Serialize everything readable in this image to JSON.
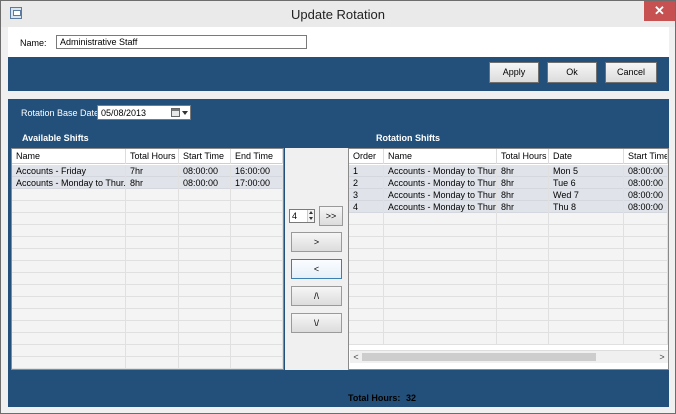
{
  "window": {
    "title": "Update Rotation",
    "close_label": "✕"
  },
  "name_field": {
    "label": "Name:",
    "value": "Administrative Staff"
  },
  "toolbar": {
    "apply_label": "Apply",
    "ok_label": "Ok",
    "cancel_label": "Cancel"
  },
  "rotation_base": {
    "label": "Rotation Base Date",
    "value": "05/08/2013"
  },
  "available": {
    "title": "Available Shifts",
    "columns": [
      "Name",
      "Total Hours",
      "Start Time",
      "End Time"
    ],
    "rows": [
      [
        "Accounts - Friday",
        "7hr",
        "08:00:00",
        "16:00:00"
      ],
      [
        "Accounts - Monday to Thur...",
        "8hr",
        "08:00:00",
        "17:00:00"
      ]
    ]
  },
  "rotation": {
    "title": "Rotation Shifts",
    "columns": [
      "Order",
      "Name",
      "Total Hours",
      "Date",
      "Start Time"
    ],
    "rows": [
      [
        "1",
        "Accounts - Monday to Thur...",
        "8hr",
        "Mon 5",
        "08:00:00"
      ],
      [
        "2",
        "Accounts - Monday to Thur...",
        "8hr",
        "Tue 6",
        "08:00:00"
      ],
      [
        "3",
        "Accounts - Monday to Thur...",
        "8hr",
        "Wed 7",
        "08:00:00"
      ],
      [
        "4",
        "Accounts - Monday to Thur...",
        "8hr",
        "Thu 8",
        "08:00:00"
      ]
    ]
  },
  "controls": {
    "repeat_count": "4",
    "add_all_label": ">>",
    "add_label": ">",
    "remove_label": "<",
    "move_up_label": "/\\",
    "move_down_label": "\\/"
  },
  "scrollbar": {
    "left_arrow": "<",
    "right_arrow": ">"
  },
  "footer": {
    "total_label": "Total Hours:",
    "total_value": "32"
  }
}
